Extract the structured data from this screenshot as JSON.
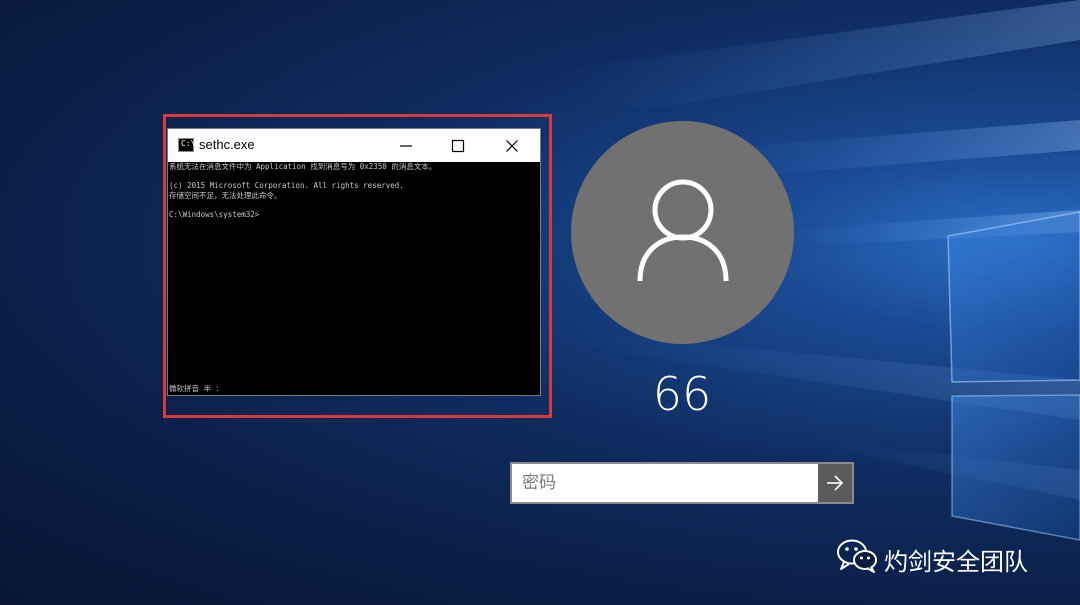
{
  "console_window": {
    "title": "sethc.exe",
    "icon": "console-app-icon",
    "icon_glyph": "C:\\",
    "lines": [
      "系统无法在消息文件中为 Application 找到消息号为 0x2350 的消息文本。",
      "",
      "(c) 2015 Microsoft Corporation. All rights reserved.",
      "存储空间不足，无法处理此命令。",
      "",
      "C:\\Windows\\system32>"
    ],
    "ime_status": "微软拼音 半 ："
  },
  "login": {
    "username": "66",
    "password_placeholder": "密码",
    "submit_icon": "arrow-right-icon"
  },
  "watermark": {
    "text": "灼剑安全团队",
    "icon": "wechat-icon"
  },
  "colors": {
    "highlight": "#d83a3a",
    "avatar_bg": "#717171",
    "submit_bg": "#5b5b5b"
  }
}
